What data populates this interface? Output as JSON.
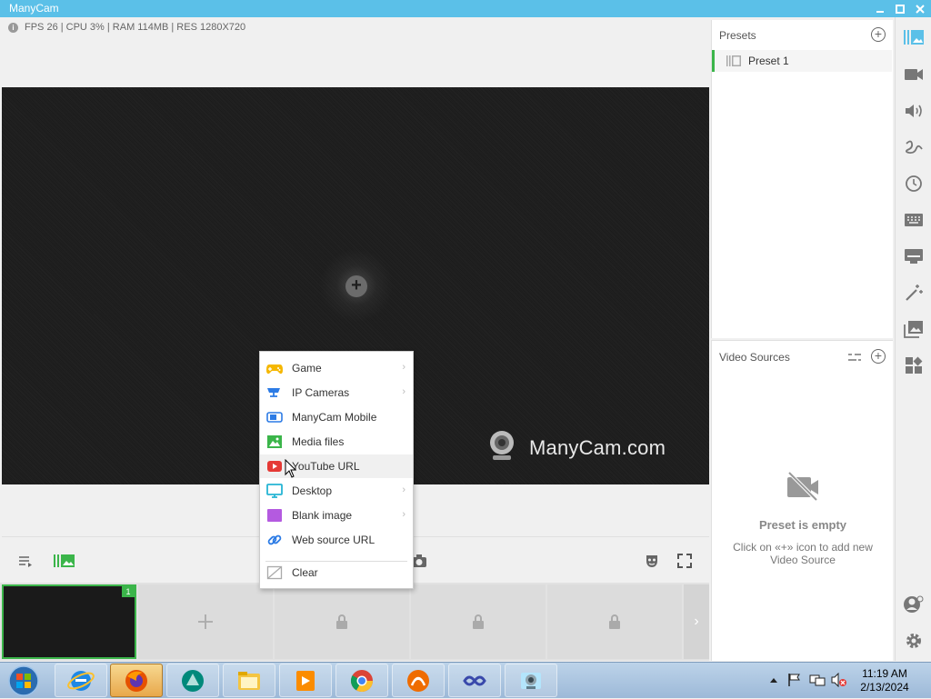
{
  "window": {
    "title": "ManyCam"
  },
  "stats": {
    "text": "FPS 26 | CPU 3% | RAM 114MB | RES 1280X720"
  },
  "preview": {
    "watermark": "ManyCam.com"
  },
  "menu": {
    "items": [
      {
        "label": "Game",
        "icon": "gamepad-icon",
        "submenu": true
      },
      {
        "label": "IP Cameras",
        "icon": "ip-camera-icon",
        "submenu": true
      },
      {
        "label": "ManyCam Mobile",
        "icon": "mobile-icon",
        "submenu": false
      },
      {
        "label": "Media files",
        "icon": "image-icon",
        "submenu": false
      },
      {
        "label": "YouTube URL",
        "icon": "youtube-icon",
        "submenu": false
      },
      {
        "label": "Desktop",
        "icon": "monitor-icon",
        "submenu": true
      },
      {
        "label": "Blank image",
        "icon": "blank-image-icon",
        "submenu": true
      },
      {
        "label": "Web source URL",
        "icon": "link-icon",
        "submenu": false
      },
      {
        "label": "Clear",
        "icon": "clear-icon",
        "submenu": false
      }
    ],
    "hovered": "YouTube URL"
  },
  "presets": {
    "header": "Presets",
    "items": [
      {
        "label": "Preset 1"
      }
    ]
  },
  "sources": {
    "header": "Video Sources",
    "empty_title": "Preset is empty",
    "empty_hint": "Click on «+» icon to add new Video Source"
  },
  "scenes": {
    "active_badge": "1"
  },
  "taskbar": {
    "time": "11:19 AM",
    "date": "2/13/2024"
  },
  "colors": {
    "accent": "#5bc0e8",
    "green": "#3bb54a"
  }
}
